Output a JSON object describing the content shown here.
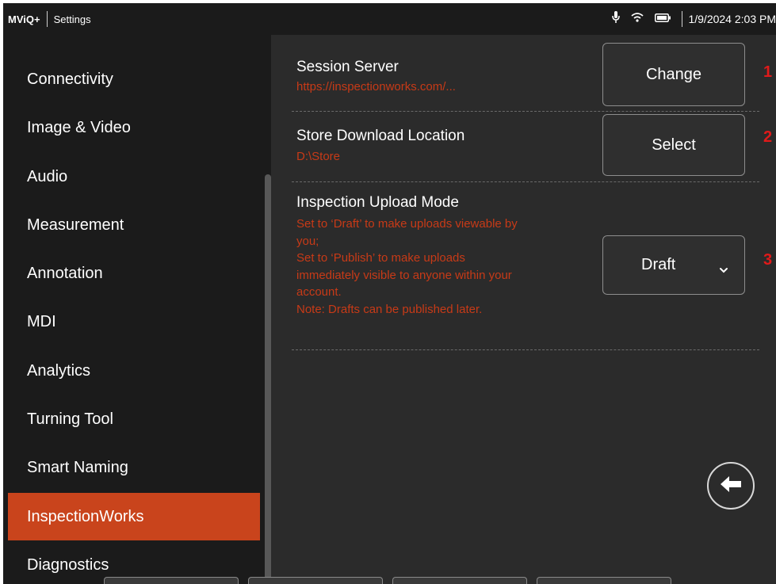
{
  "status_bar": {
    "app_name": "MViQ+",
    "page_title": "Settings",
    "datetime": "1/9/2024  2:03 PM",
    "icons": [
      "microphone-icon",
      "wifi-icon",
      "battery-icon"
    ]
  },
  "sidebar": {
    "items": [
      {
        "label": "Connectivity"
      },
      {
        "label": "Image & Video"
      },
      {
        "label": "Audio"
      },
      {
        "label": "Measurement"
      },
      {
        "label": "Annotation"
      },
      {
        "label": "MDI"
      },
      {
        "label": "Analytics"
      },
      {
        "label": "Turning Tool"
      },
      {
        "label": "Smart Naming"
      },
      {
        "label": "InspectionWorks",
        "active": true
      },
      {
        "label": "Diagnostics"
      }
    ]
  },
  "settings": {
    "session_server": {
      "title": "Session Server",
      "value": "https://inspectionworks.com/...",
      "button_label": "Change",
      "marker": "1"
    },
    "store_download": {
      "title": "Store Download Location",
      "value": "D:\\Store",
      "button_label": "Select",
      "marker": "2"
    },
    "upload_mode": {
      "title": "Inspection Upload Mode",
      "desc_lines": [
        "Set to ‘Draft’ to make uploads viewable by",
        "you;",
        "Set to ‘Publish’ to make uploads",
        "immediately visible to anyone within your",
        "account.",
        "Note: Drafts can be published later."
      ],
      "selected": "Draft",
      "marker": "3"
    }
  },
  "colors": {
    "accent": "#c9441c",
    "value_text": "#c73a17",
    "marker": "#e01a1a",
    "sidebar_bg": "#1b1b1b",
    "content_bg": "#2b2b2b"
  }
}
